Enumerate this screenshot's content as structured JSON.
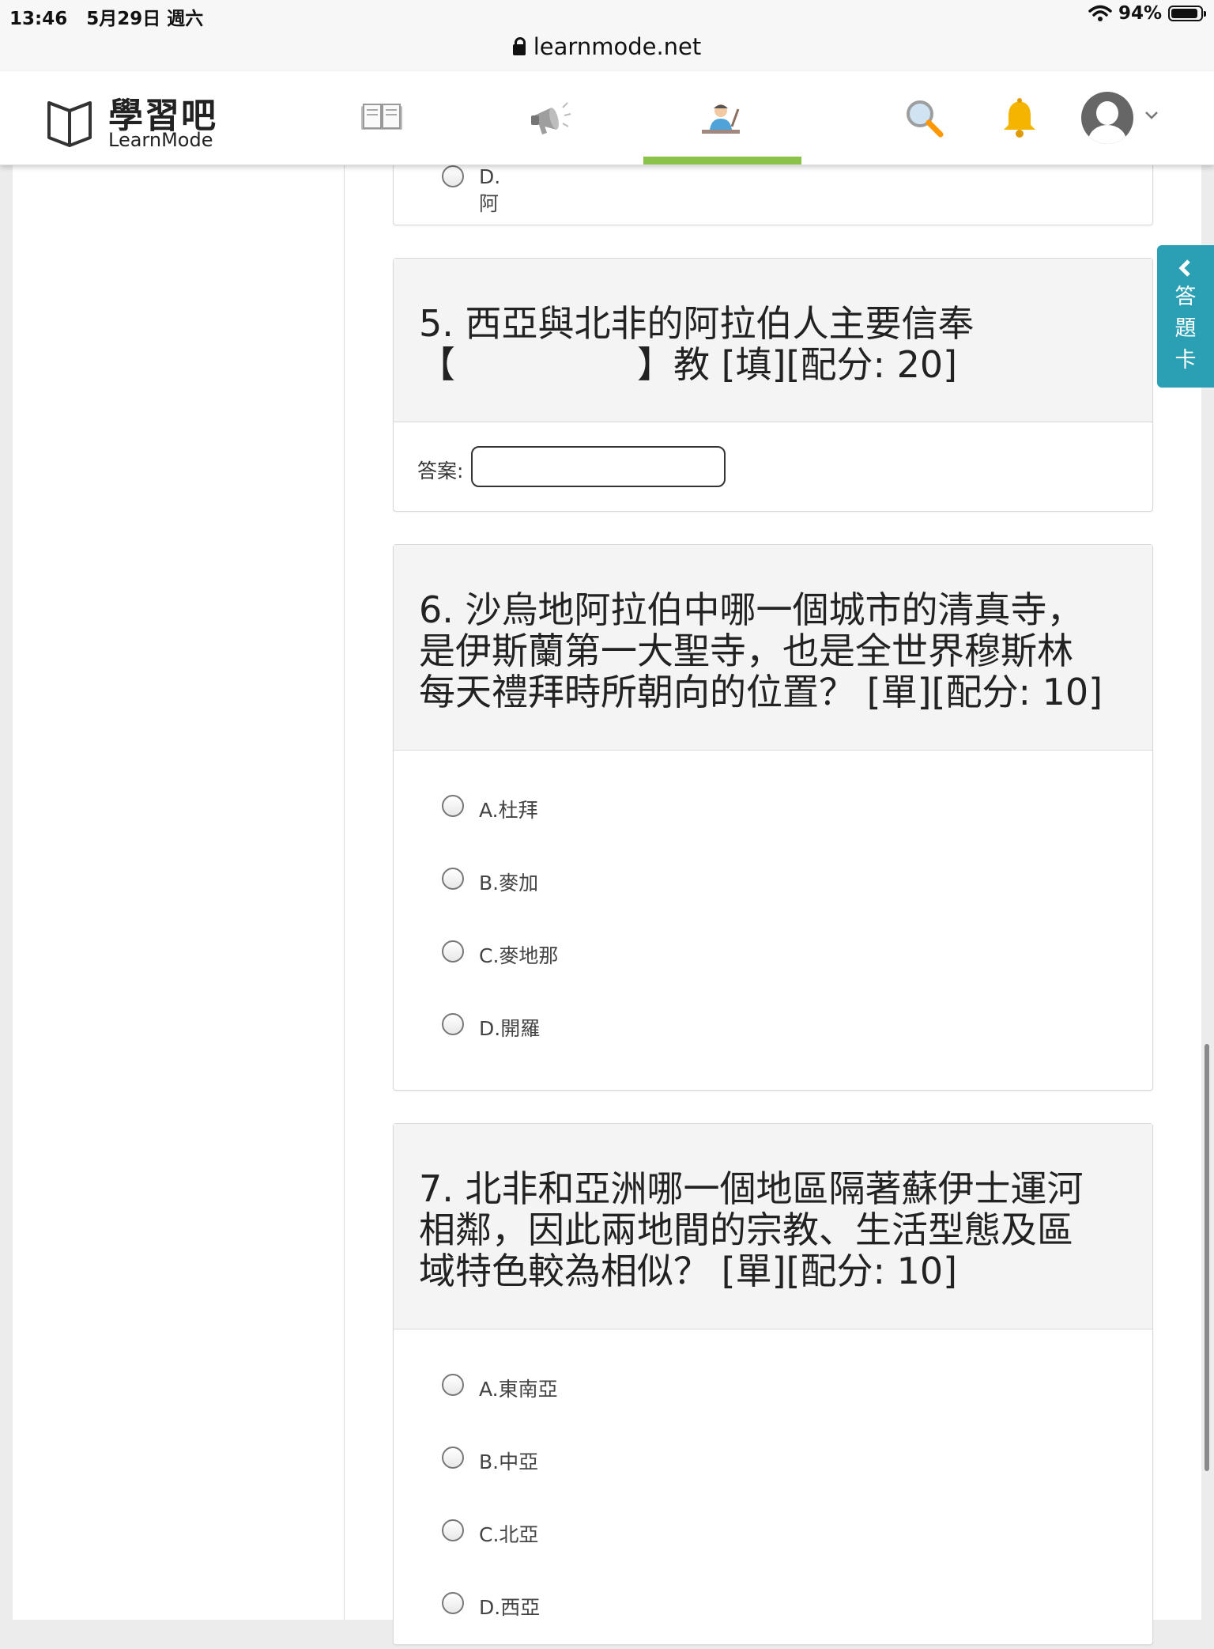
{
  "status_bar": {
    "time": "13:46",
    "date": "5月29日 週六",
    "battery": "94%"
  },
  "url_bar": {
    "url": "learnmode.net"
  },
  "header": {
    "logo_title": "學習吧",
    "logo_subtitle": "LearnMode",
    "nav": [
      {
        "icon": "book-icon"
      },
      {
        "icon": "megaphone-icon"
      },
      {
        "icon": "teacher-icon",
        "active": true
      },
      {
        "icon": "search-icon"
      },
      {
        "icon": "bell-icon"
      }
    ],
    "accent_color": "#8bc34a"
  },
  "side_tab": {
    "c1": "答",
    "c2": "題",
    "c3": "卡"
  },
  "partial_option": "D.阿",
  "q5": {
    "line1": "5. 西亞與北非的阿拉伯人主要信奉",
    "line2": "【　　　　　】教 [填][配分: 20]",
    "answer_label": "答案:",
    "answer_value": ""
  },
  "q6": {
    "line1": "6. 沙烏地阿拉伯中哪一個城市的清真寺，",
    "line2": "是伊斯蘭第一大聖寺，也是全世界穆斯林",
    "line3": "每天禮拜時所朝向的位置？ [單][配分: 10]",
    "options": [
      "A.杜拜",
      "B.麥加",
      "C.麥地那",
      "D.開羅"
    ]
  },
  "q7": {
    "line1": "7. 北非和亞洲哪一個地區隔著蘇伊士運河",
    "line2": "相鄰，因此兩地間的宗教、生活型態及區",
    "line3": "域特色較為相似？ [單][配分: 10]",
    "options": [
      "A.東南亞",
      "B.中亞",
      "C.北亞",
      "D.西亞"
    ]
  }
}
